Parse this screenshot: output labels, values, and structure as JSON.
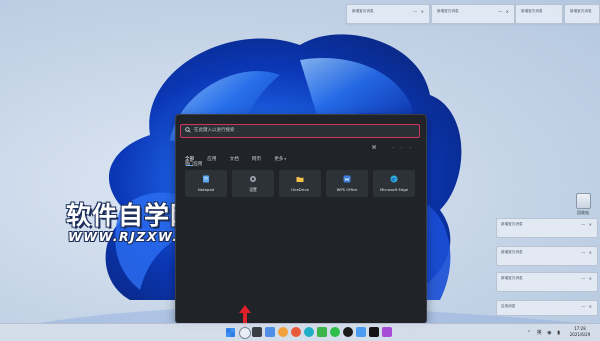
{
  "top_notifications": [
    {
      "text": "新增宝贝消息",
      "controls": "— ✕"
    },
    {
      "text": "新增宝贝消息",
      "controls": "— ✕"
    },
    {
      "text": "新增宝贝消息",
      "controls": "— ✕"
    },
    {
      "text": "新增宝贝消息",
      "controls": "— ✕"
    }
  ],
  "side_notifications": [
    {
      "text": "新增宝贝消息",
      "controls": "— ✕"
    },
    {
      "text": "新增宝贝消息",
      "controls": "— ✕"
    },
    {
      "text": "新增宝贝消息",
      "controls": "— ✕"
    },
    {
      "text": "应用消息",
      "controls": "— ✕"
    }
  ],
  "watermark": {
    "title": "软件自学网",
    "url": "WWW.RJZXW.COM"
  },
  "desktop_icon": {
    "label": "回收站",
    "icon": "recycle-bin-icon"
  },
  "search": {
    "placeholder": "在此键入以进行搜索",
    "tabs": [
      "全部",
      "应用",
      "文档",
      "网页",
      "更多"
    ],
    "more_caret": "▾",
    "header_icons": "⌘ ···",
    "section_title": "热门应用",
    "apps": [
      {
        "label": "Notepad",
        "icon": "notepad-icon",
        "color": "#5aa9f2"
      },
      {
        "label": "设置",
        "icon": "settings-gear-icon",
        "color": "#9aa4b0"
      },
      {
        "label": "OneDrive",
        "icon": "onedrive-folder-icon",
        "color": "#f2c14a"
      },
      {
        "label": "WPS Office",
        "icon": "wps-office-icon",
        "color": "#3d7fe0"
      },
      {
        "label": "Microsoft Edge",
        "icon": "edge-icon",
        "color": "#2fb3d8"
      }
    ]
  },
  "taskbar": {
    "icons": [
      "start-icon",
      "search-icon",
      "task-view-icon",
      "widgets-icon",
      "chat-icon",
      "explorer-icon",
      "edge-icon",
      "store-icon",
      "wechat-icon",
      "qq-icon",
      "media-icon",
      "tiktok-icon",
      "app-icon"
    ],
    "tray": "⌃ 英 ◉ ▮",
    "time": "17:28",
    "date": "2021/6/29"
  },
  "colors": {
    "accent": "#5ca7f6",
    "search_border": "#d0335a",
    "panel_bg": "#202429",
    "arrow": "#e0202a"
  }
}
